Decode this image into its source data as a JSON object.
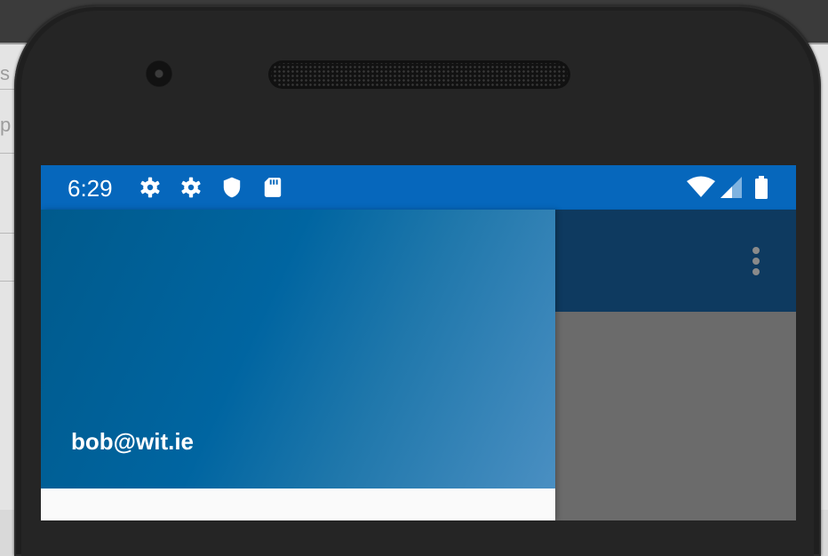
{
  "status_bar": {
    "time": "6:29",
    "left_icons": [
      "gear-icon",
      "gear-icon",
      "shield-icon",
      "sd-card-icon"
    ],
    "right_icons": [
      "wifi-icon",
      "cell-signal-icon",
      "battery-icon"
    ],
    "color": "#0667bc"
  },
  "toolbar": {
    "overflow_icon": "more-vert-icon",
    "color": "#0e3a60"
  },
  "drawer": {
    "user_email": "bob@wit.ie",
    "header_gradient": [
      "#005a8c",
      "#4a8fc2"
    ]
  },
  "host_window": {
    "partial_letters": [
      "s",
      "p"
    ]
  }
}
